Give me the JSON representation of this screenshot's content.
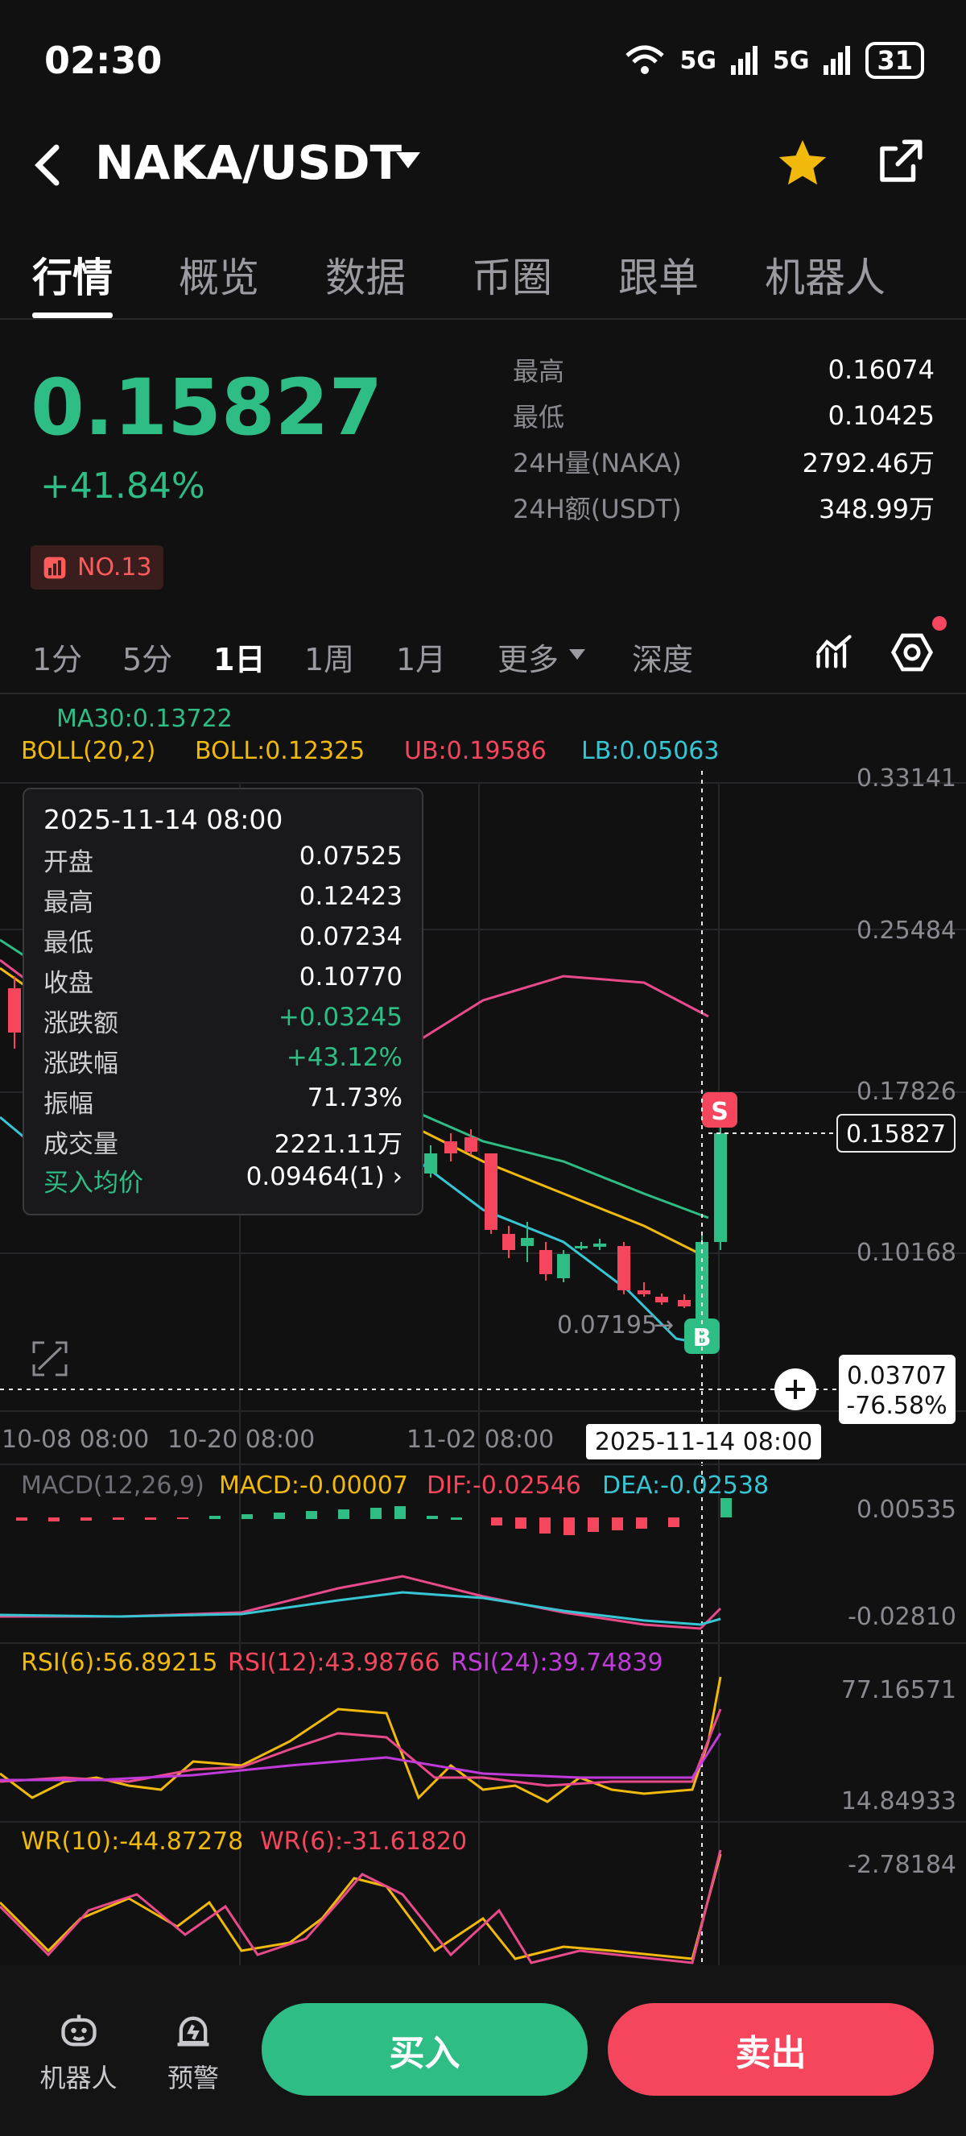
{
  "status": {
    "time": "02:30",
    "net1": "5G",
    "net2": "5G",
    "battery": "31"
  },
  "header": {
    "pair": "NAKA/USDT"
  },
  "tabs": [
    "行情",
    "概览",
    "数据",
    "币圈",
    "跟单",
    "机器人"
  ],
  "ticker": {
    "price": "0.15827",
    "change": "+41.84%",
    "rank": "NO.13",
    "stats": [
      {
        "label": "最高",
        "value": "0.16074"
      },
      {
        "label": "最低",
        "value": "0.10425"
      },
      {
        "label": "24H量(NAKA)",
        "value": "2792.46万"
      },
      {
        "label": "24H额(USDT)",
        "value": "348.99万"
      }
    ]
  },
  "intervals": [
    "1分",
    "5分",
    "1日",
    "1周",
    "1月",
    "更多",
    "深度"
  ],
  "indicators": {
    "ma30": "MA30:0.13722",
    "boll": "BOLL(20,2)",
    "boll_val": "BOLL:0.12325",
    "ub": "UB:0.19586",
    "lb": "LB:0.05063",
    "macd_title": "MACD(12,26,9)",
    "macd": "MACD:-0.00007",
    "dif": "DIF:-0.02546",
    "dea": "DEA:-0.02538",
    "rsi6": "RSI(6):56.89215",
    "rsi12": "RSI(12):43.98766",
    "rsi24": "RSI(24):39.74839",
    "wr10": "WR(10):-44.87278",
    "wr6": "WR(6):-31.61820"
  },
  "axis": {
    "price_ticks": [
      "0.33141",
      "0.25484",
      "0.17826",
      "0.10168"
    ],
    "current_price": "0.15827",
    "cursor_price": "0.03707",
    "cursor_pct": "-76.58%",
    "low_marker": "0.07195",
    "dates": [
      "10-08 08:00",
      "10-20 08:00",
      "11-02 08:00"
    ],
    "cursor_date": "2025-11-14 08:00",
    "macd_ticks": [
      "0.00535",
      "-0.02810"
    ],
    "rsi_ticks": [
      "77.16571",
      "14.84933"
    ],
    "wr_ticks": [
      "-2.78184"
    ],
    "sell_tag": "S",
    "buy_tag": "B"
  },
  "tooltip": {
    "date": "2025-11-14 08:00",
    "rows": [
      {
        "label": "开盘",
        "value": "0.07525"
      },
      {
        "label": "最高",
        "value": "0.12423"
      },
      {
        "label": "最低",
        "value": "0.07234"
      },
      {
        "label": "收盘",
        "value": "0.10770"
      },
      {
        "label": "涨跌额",
        "value": "+0.03245"
      },
      {
        "label": "涨跌幅",
        "value": "+43.12%"
      },
      {
        "label": "振幅",
        "value": "71.73%"
      },
      {
        "label": "成交量",
        "value": "2221.11万"
      },
      {
        "label": "买入均价",
        "value": "0.09464(1)"
      }
    ]
  },
  "bottom": {
    "robot": "机器人",
    "alert": "预警",
    "buy": "买入",
    "sell": "卖出"
  },
  "colors": {
    "up": "#2ebd85",
    "down": "#f6465d",
    "star": "#f0b90b"
  }
}
